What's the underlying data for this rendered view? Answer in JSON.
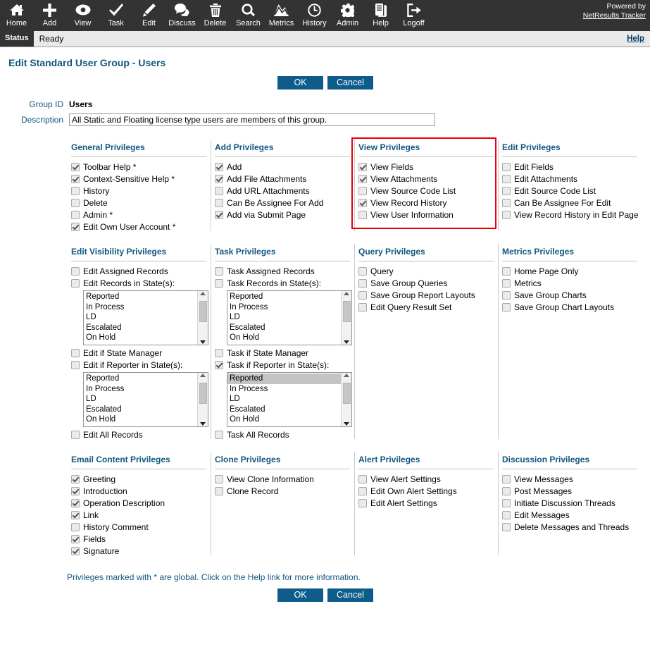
{
  "toolbar": {
    "items": [
      {
        "label": "Home",
        "icon": "home-icon"
      },
      {
        "label": "Add",
        "icon": "plus-icon"
      },
      {
        "label": "View",
        "icon": "eye-icon"
      },
      {
        "label": "Task",
        "icon": "check-icon"
      },
      {
        "label": "Edit",
        "icon": "pencil-icon"
      },
      {
        "label": "Discuss",
        "icon": "speech-bubbles-icon"
      },
      {
        "label": "Delete",
        "icon": "trash-icon"
      },
      {
        "label": "Search",
        "icon": "magnifier-icon"
      },
      {
        "label": "Metrics",
        "icon": "chart-icon"
      },
      {
        "label": "History",
        "icon": "clock-icon"
      },
      {
        "label": "Admin",
        "icon": "gear-icon"
      },
      {
        "label": "Help",
        "icon": "document-icon"
      },
      {
        "label": "Logoff",
        "icon": "exit-icon"
      }
    ],
    "powered_by": "Powered by",
    "brand": "NetResults Tracker"
  },
  "statusbar": {
    "tag": "Status",
    "text": "Ready",
    "help": "Help"
  },
  "page": {
    "title": "Edit Standard User Group - Users",
    "footnote": "Privileges marked with * are global. Click on the Help link for more information."
  },
  "buttons": {
    "ok": "OK",
    "cancel": "Cancel"
  },
  "form": {
    "group_id_label": "Group ID",
    "group_id_value": "Users",
    "description_label": "Description",
    "description_value": "All Static and Floating license type users are members of this group."
  },
  "colors": {
    "toolbar_bg": "#333333",
    "accent_blue": "#10577f",
    "button_bg": "#0d5c8a",
    "highlight_red": "#e8000d"
  },
  "states": [
    "Reported",
    "In Process",
    "LD",
    "Escalated",
    "On Hold"
  ],
  "privileges": {
    "row1": [
      {
        "title": "General Privileges",
        "items": [
          {
            "label": "Toolbar Help *",
            "checked": true
          },
          {
            "label": "Context-Sensitive Help *",
            "checked": true
          },
          {
            "label": "History",
            "checked": false
          },
          {
            "label": "Delete",
            "checked": false
          },
          {
            "label": "Admin *",
            "checked": false
          },
          {
            "label": "Edit Own User Account *",
            "checked": true
          }
        ]
      },
      {
        "title": "Add Privileges",
        "items": [
          {
            "label": "Add",
            "checked": true
          },
          {
            "label": "Add File Attachments",
            "checked": true
          },
          {
            "label": "Add URL Attachments",
            "checked": false
          },
          {
            "label": "Can Be Assignee For Add",
            "checked": false
          },
          {
            "label": "Add via Submit Page",
            "checked": true
          }
        ]
      },
      {
        "title": "View Privileges",
        "highlighted": true,
        "items": [
          {
            "label": "View Fields",
            "checked": true
          },
          {
            "label": "View Attachments",
            "checked": true
          },
          {
            "label": "View Source Code List",
            "checked": false
          },
          {
            "label": "View Record History",
            "checked": true
          },
          {
            "label": "View User Information",
            "checked": false
          }
        ]
      },
      {
        "title": "Edit Privileges",
        "items": [
          {
            "label": "Edit Fields",
            "checked": false
          },
          {
            "label": "Edit Attachments",
            "checked": false
          },
          {
            "label": "Edit Source Code List",
            "checked": false
          },
          {
            "label": "Can Be Assignee For Edit",
            "checked": false
          },
          {
            "label": "View Record History in Edit Page",
            "checked": false
          }
        ]
      }
    ],
    "row2": [
      {
        "title": "Edit Visibility Privileges",
        "items": [
          {
            "label": "Edit Assigned Records",
            "checked": false
          },
          {
            "label": "Edit Records in State(s):",
            "checked": false,
            "list": true,
            "selected": null
          },
          {
            "label": "Edit if State Manager",
            "checked": false
          },
          {
            "label": "Edit if Reporter in State(s):",
            "checked": false,
            "list": true,
            "selected": null
          },
          {
            "label": "Edit All Records",
            "checked": false
          }
        ]
      },
      {
        "title": "Task Privileges",
        "items": [
          {
            "label": "Task Assigned Records",
            "checked": false
          },
          {
            "label": "Task Records in State(s):",
            "checked": false,
            "list": true,
            "selected": null
          },
          {
            "label": "Task if State Manager",
            "checked": false
          },
          {
            "label": "Task if Reporter in State(s):",
            "checked": true,
            "list": true,
            "selected": "Reported"
          },
          {
            "label": "Task All Records",
            "checked": false
          }
        ]
      },
      {
        "title": "Query Privileges",
        "items": [
          {
            "label": "Query",
            "checked": false
          },
          {
            "label": "Save Group Queries",
            "checked": false
          },
          {
            "label": "Save Group Report Layouts",
            "checked": false
          },
          {
            "label": "Edit Query Result Set",
            "checked": false
          }
        ]
      },
      {
        "title": "Metrics Privileges",
        "items": [
          {
            "label": "Home Page Only",
            "checked": false
          },
          {
            "label": "Metrics",
            "checked": false
          },
          {
            "label": "Save Group Charts",
            "checked": false
          },
          {
            "label": "Save Group Chart Layouts",
            "checked": false
          }
        ]
      }
    ],
    "row3": [
      {
        "title": "Email Content Privileges",
        "items": [
          {
            "label": "Greeting",
            "checked": true
          },
          {
            "label": "Introduction",
            "checked": true
          },
          {
            "label": "Operation Description",
            "checked": true
          },
          {
            "label": "Link",
            "checked": true
          },
          {
            "label": "History Comment",
            "checked": false
          },
          {
            "label": "Fields",
            "checked": true
          },
          {
            "label": "Signature",
            "checked": true
          }
        ]
      },
      {
        "title": "Clone Privileges",
        "items": [
          {
            "label": "View Clone Information",
            "checked": false
          },
          {
            "label": "Clone Record",
            "checked": false
          }
        ]
      },
      {
        "title": "Alert Privileges",
        "items": [
          {
            "label": "View Alert Settings",
            "checked": false
          },
          {
            "label": "Edit Own Alert Settings",
            "checked": false
          },
          {
            "label": "Edit Alert Settings",
            "checked": false
          }
        ]
      },
      {
        "title": "Discussion Privileges",
        "items": [
          {
            "label": "View Messages",
            "checked": false
          },
          {
            "label": "Post Messages",
            "checked": false
          },
          {
            "label": "Initiate Discussion Threads",
            "checked": false
          },
          {
            "label": "Edit Messages",
            "checked": false
          },
          {
            "label": "Delete Messages and Threads",
            "checked": false
          }
        ]
      }
    ]
  }
}
